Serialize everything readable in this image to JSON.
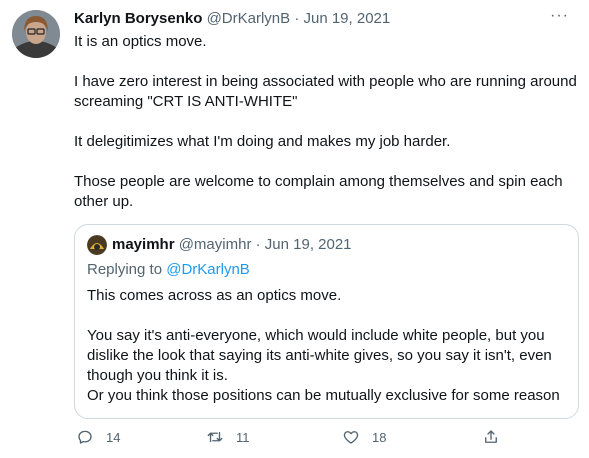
{
  "author": {
    "name": "Karlyn Borysenko",
    "handle": "@DrKarlynB",
    "date": "Jun 19, 2021",
    "separator": "·"
  },
  "more_label": "···",
  "tweet": {
    "paragraphs": [
      "It is an optics move.",
      "I have zero interest in being associated with people who are running around screaming \"CRT IS ANTI-WHITE\"",
      "It delegitimizes what I'm doing and makes my job harder.",
      "Those people are welcome to complain among themselves and spin each other up."
    ]
  },
  "quote": {
    "name": "mayimhr",
    "handle": "@mayimhr",
    "separator": "·",
    "date": "Jun 19, 2021",
    "replying_prefix": "Replying to",
    "replying_to": "@DrKarlynB",
    "paragraphs": [
      "This comes across as an optics move.",
      "You say it's anti-everyone, which would include white people, but you dislike the look that saying its anti-white gives, so you say it isn't, even though you think it is.",
      "Or you think those positions can be mutually exclusive for some reason"
    ]
  },
  "actions": {
    "replies": "14",
    "retweets": "11",
    "likes": "18"
  },
  "colors": {
    "text": "#0f1419",
    "secondary": "#536471",
    "accent": "#1d9bf0",
    "border": "#cfd9de"
  }
}
